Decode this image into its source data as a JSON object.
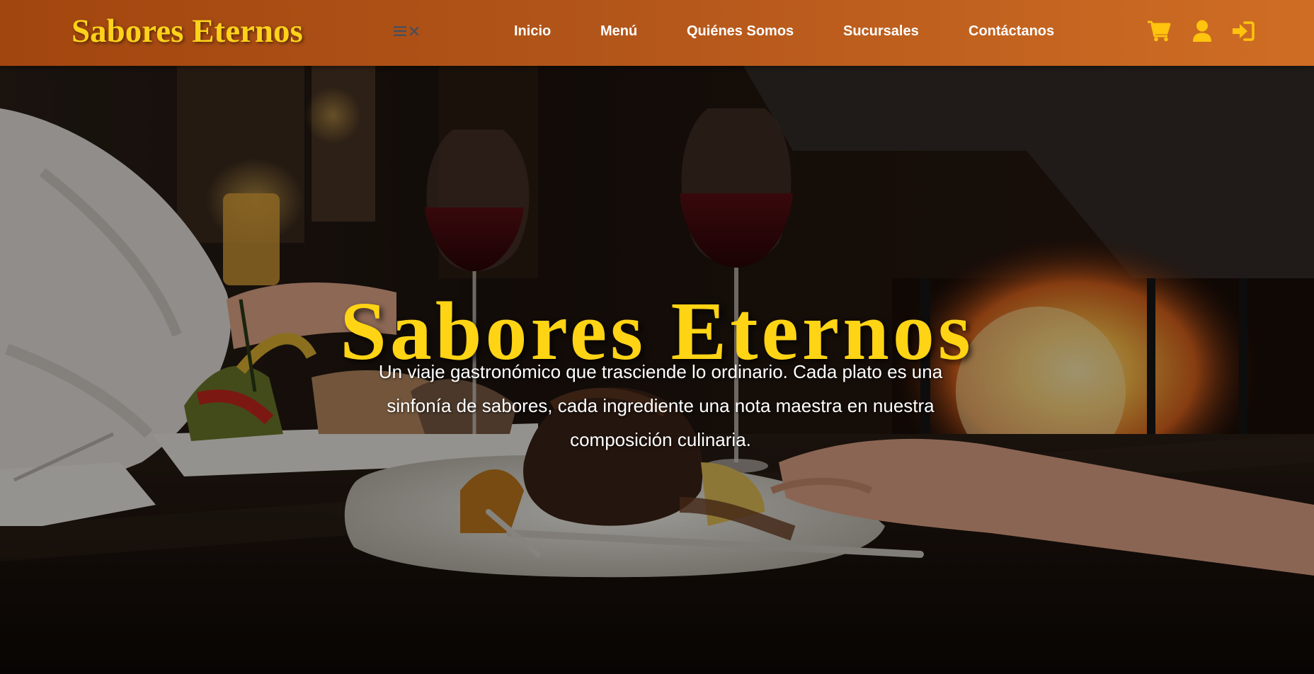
{
  "navbar": {
    "brand": "Sabores Eternos",
    "links": {
      "inicio": "Inicio",
      "menu": "Menú",
      "quienes": "Quiénes Somos",
      "sucursales": "Sucursales",
      "contacto": "Contáctanos"
    },
    "icons": [
      "menu-icon",
      "close-icon",
      "cart-icon",
      "user-icon",
      "login-icon"
    ]
  },
  "hero": {
    "title": "Sabores Eternos",
    "text": "Un viaje gastronómico que trasciende lo ordinario. Cada plato es una sinfonía de sabores, cada ingrediente una nota maestra en nuestra composición culinaria."
  },
  "colors": {
    "navbar_start": "#a2460f",
    "navbar_end": "#cf6d24",
    "accent_yellow": "#ffd414",
    "text_white": "#ffffff"
  }
}
